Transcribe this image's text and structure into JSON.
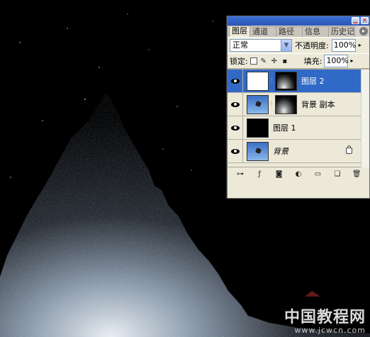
{
  "panel": {
    "tabs": [
      {
        "label": "图层",
        "active": true
      },
      {
        "label": "通道"
      },
      {
        "label": "路径"
      },
      {
        "label": "信息"
      },
      {
        "label": "历史记录"
      }
    ],
    "blend_mode": "正常",
    "opacity_label": "不透明度:",
    "opacity_value": "100%",
    "lock_label": "锁定:",
    "fill_label": "填充:",
    "fill_value": "100%",
    "layers": [
      {
        "name": "图层 2",
        "thumbnail": "white",
        "mask": true,
        "selected": true,
        "visible": true
      },
      {
        "name": "背景 副本",
        "thumbnail": "sky",
        "mask": true,
        "selected": false,
        "visible": true
      },
      {
        "name": "图层 1",
        "thumbnail": "black",
        "mask": false,
        "selected": false,
        "visible": true
      },
      {
        "name": "背景",
        "thumbnail": "sky",
        "mask": false,
        "selected": false,
        "visible": true,
        "locked": true
      }
    ],
    "icons": [
      "link-icon",
      "fx-icon",
      "mask-icon",
      "adjustment-icon",
      "folder-icon",
      "new-layer-icon",
      "trash-icon"
    ]
  },
  "watermark": {
    "text": "中国教程网",
    "url": "www.jcwcn.com"
  },
  "colors": {
    "selection": "#3169c6",
    "panel_bg": "#ece9d8",
    "titlebar": "#2a55b5"
  }
}
